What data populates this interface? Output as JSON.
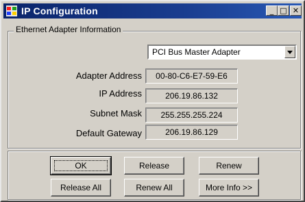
{
  "window": {
    "title": "IP Configuration",
    "controls": {
      "minimize": "_",
      "maximize": "□",
      "close": "✕"
    }
  },
  "group": {
    "label": "Ethernet  Adapter Information"
  },
  "adapter_select": {
    "selected": "PCI Bus Master Adapter"
  },
  "fields": [
    {
      "label": "Adapter Address",
      "value": "00-80-C6-E7-59-E6"
    },
    {
      "label": "IP Address",
      "value": "206.19.86.132"
    },
    {
      "label": "Subnet Mask",
      "value": "255.255.255.224"
    },
    {
      "label": "Default Gateway",
      "value": "206.19.86.129"
    }
  ],
  "buttons": {
    "ok": "OK",
    "release": "Release",
    "renew": "Renew",
    "release_all": "Release All",
    "renew_all": "Renew All",
    "more_info": "More Info >>"
  },
  "colors": {
    "title_bar": "#0a246a",
    "face": "#d4d0c8"
  }
}
